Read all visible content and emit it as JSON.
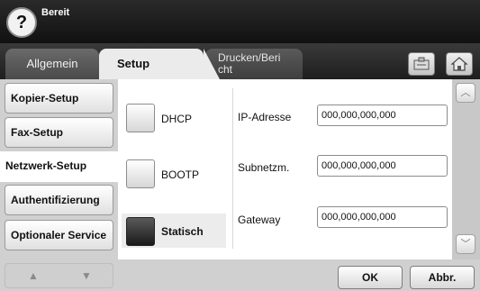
{
  "header": {
    "help_icon_glyph": "?",
    "status": "Bereit"
  },
  "tabs": {
    "allgemein": "Allgemein",
    "setup": "Setup",
    "drucken_line1": "Drucken/Beri",
    "drucken_line2": "cht"
  },
  "toolbar_icons": [
    "job-status-icon",
    "home-icon"
  ],
  "nav": {
    "items": [
      "Kopier-Setup",
      "Fax-Setup",
      "Netzwerk-Setup",
      "Authentifizierung",
      "Optionaler Service"
    ],
    "active": "Netzwerk-Setup"
  },
  "options": [
    {
      "label": "DHCP",
      "checked": false
    },
    {
      "label": "BOOTP",
      "checked": false
    },
    {
      "label": "Statisch",
      "checked": true
    }
  ],
  "fields": [
    {
      "label": "IP-Adresse",
      "value": "000,000,000,000"
    },
    {
      "label": "Subnetzm.",
      "value": "000,000,000,000"
    },
    {
      "label": "Gateway",
      "value": "000,000,000,000"
    }
  ],
  "actions": {
    "ok": "OK",
    "cancel": "Abbr."
  }
}
